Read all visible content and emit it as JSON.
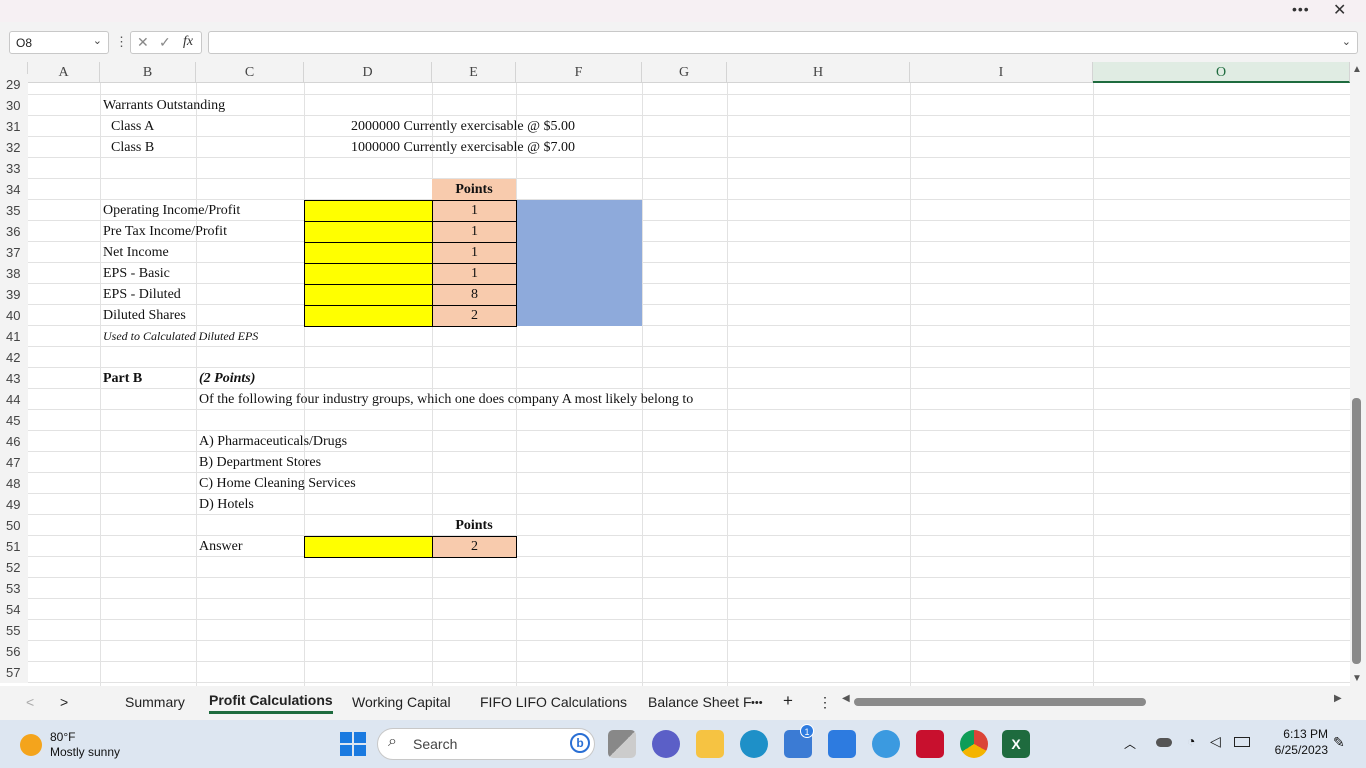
{
  "window": {
    "more_label": "•••",
    "close_label": "✕"
  },
  "formula_bar": {
    "name_box": "O8",
    "fx_label": "fx",
    "cancel_icon": "✕",
    "enter_icon": "✓",
    "formula": ""
  },
  "columns": [
    "A",
    "B",
    "C",
    "D",
    "E",
    "F",
    "G",
    "H",
    "I",
    "O"
  ],
  "rows": [
    "29",
    "30",
    "31",
    "32",
    "33",
    "34",
    "35",
    "36",
    "37",
    "38",
    "39",
    "40",
    "41",
    "42",
    "43",
    "44",
    "45",
    "46",
    "47",
    "48",
    "49",
    "50",
    "51",
    "52",
    "53",
    "54",
    "55",
    "56",
    "57"
  ],
  "cells": {
    "b30": "Warrants Outstanding",
    "b31": "Class A",
    "d31": "2000000 Currently exercisable @ $5.00",
    "b32": "Class B",
    "d32": "1000000 Currently exercisable @ $7.00",
    "e34": "Points",
    "b35": "Operating Income/Profit",
    "e35": "1",
    "b36": "Pre Tax Income/Profit",
    "e36": "1",
    "b37": "Net Income",
    "e37": "1",
    "b38": "EPS - Basic",
    "e38": "1",
    "b39": "EPS - Diluted",
    "e39": "8",
    "b40": "Diluted Shares",
    "e40": "2",
    "b41": "Used to Calculated Diluted EPS",
    "b43": "Part B",
    "c43": "(2 Points)",
    "c44": "Of the following four industry groups, which one does company A most likely belong to",
    "c46": "A) Pharmaceuticals/Drugs",
    "c47": "B) Department Stores",
    "c48": "C) Home Cleaning Services",
    "c49": "D) Hotels",
    "e50": "Points",
    "c51": "Answer",
    "e51": "2"
  },
  "sheet_tabs": [
    "Summary",
    "Profit Calculations",
    "Working Capital",
    "FIFO LIFO Calculations",
    "Balance Sheet F"
  ],
  "active_tab": "Profit Calculations",
  "tab_controls": {
    "more": "•••",
    "add": "+",
    "options": "⋮",
    "prev": "<",
    "next": ">"
  },
  "taskbar": {
    "weather_temp": "80°F",
    "weather_desc": "Mostly sunny",
    "search_placeholder": "Search",
    "time": "6:13 PM",
    "date": "6/25/2023",
    "store_badge": "1"
  },
  "colors": {
    "yellow": "#ffff00",
    "peach": "#f8cbad",
    "blue": "#8eaadb",
    "excel_green": "#1e6b3e"
  }
}
